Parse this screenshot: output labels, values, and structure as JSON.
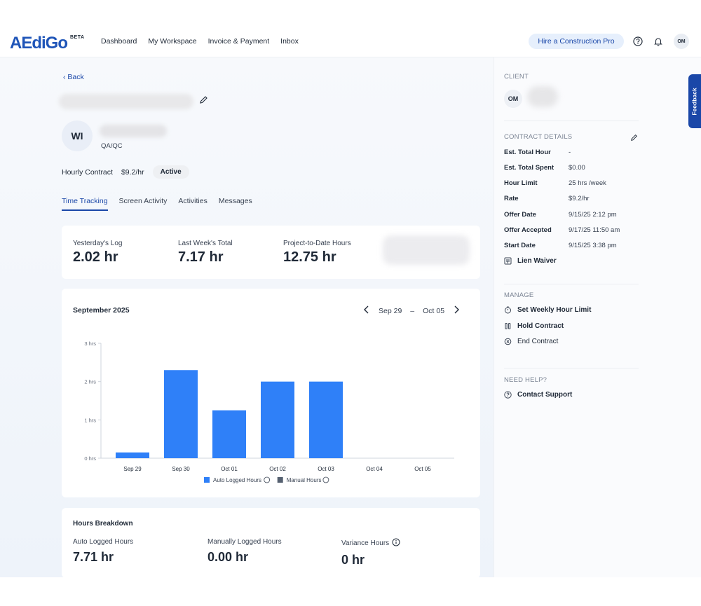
{
  "header": {
    "logo": "AEdiGo",
    "beta": "BETA",
    "nav": [
      "Dashboard",
      "My Workspace",
      "Invoice & Payment",
      "Inbox"
    ],
    "hire_button": "Hire a Construction Pro",
    "avatar": "OM"
  },
  "page": {
    "back": "‹  Back",
    "initials": "WI",
    "role": "QA/QC",
    "contract_type": "Hourly Contract",
    "rate": "$9.2/hr",
    "status": "Active"
  },
  "tabs": [
    "Time Tracking",
    "Screen Activity",
    "Activities",
    "Messages"
  ],
  "stats": [
    {
      "label": "Yesterday's Log",
      "value": "2.02 hr"
    },
    {
      "label": "Last Week's Total",
      "value": "7.17 hr"
    },
    {
      "label": "Project-to-Date Hours",
      "value": "12.75 hr"
    }
  ],
  "chart_data": {
    "type": "bar",
    "title": "September 2025",
    "range_start": "Sep 29",
    "range_sep": "–",
    "range_end": "Oct 05",
    "categories": [
      "Sep 29",
      "Sep 30",
      "Oct 01",
      "Oct 02",
      "Oct 03",
      "Oct 04",
      "Oct 05"
    ],
    "y_ticks": [
      "0 hrs",
      "1 hrs",
      "2 hrs",
      "3 hrs"
    ],
    "ylim": [
      0,
      3
    ],
    "series": [
      {
        "name": "Auto Logged Hours",
        "values": [
          0.15,
          2.3,
          1.25,
          2.0,
          2.0,
          0,
          0
        ],
        "color": "#2f80f8"
      },
      {
        "name": "Manual Hours",
        "values": [
          0,
          0,
          0,
          0,
          0,
          0,
          0
        ],
        "color": "#556070"
      }
    ],
    "legend": "bottom"
  },
  "breakdown": {
    "title": "Hours Breakdown",
    "items": [
      {
        "label": "Auto Logged Hours",
        "value": "7.71 hr"
      },
      {
        "label": "Manually Logged Hours",
        "value": "0.00 hr"
      },
      {
        "label": "Variance Hours",
        "value": "0 hr"
      }
    ]
  },
  "sidebar": {
    "client_label": "CLIENT",
    "client_initials": "OM",
    "contract_label": "CONTRACT DETAILS",
    "details": [
      {
        "k": "Est. Total Hour",
        "v": "-"
      },
      {
        "k": "Est. Total Spent",
        "v": "$0.00"
      },
      {
        "k": "Hour Limit",
        "v": "25 hrs /week"
      },
      {
        "k": "Rate",
        "v": "$9.2/hr"
      },
      {
        "k": "Offer Date",
        "v": "9/15/25 2:12 pm"
      },
      {
        "k": "Offer Accepted",
        "v": "9/17/25 11:50 am"
      },
      {
        "k": "Start Date",
        "v": "9/15/25 3:38 pm"
      }
    ],
    "lien_waiver": "Lien Waiver",
    "manage_label": "MANAGE",
    "manage": [
      "Set Weekly Hour Limit",
      "Hold Contract",
      "End Contract"
    ],
    "help_label": "NEED HELP?",
    "contact": "Contact Support"
  },
  "feedback": "Feedback"
}
